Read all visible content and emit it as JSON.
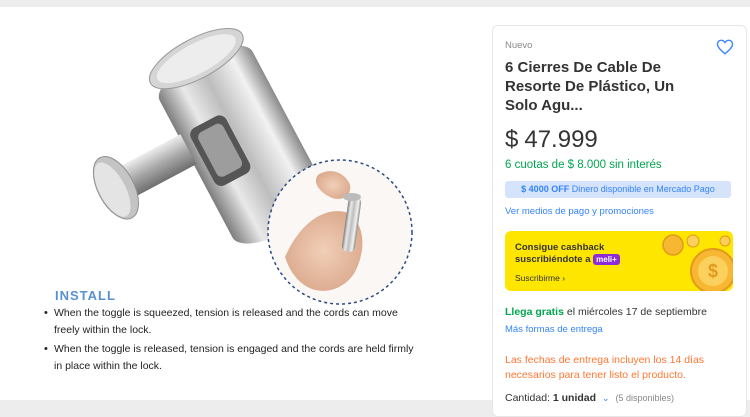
{
  "install": {
    "title": "INSTALL",
    "items": [
      "When the toggle is squeezed, tension is released and the cords can move freely within the lock.",
      "When the toggle is released, tension is engaged and the cords are held firmly in place within the lock."
    ]
  },
  "product": {
    "condition": "Nuevo",
    "title": "6 Cierres De Cable De Resorte De Plástico, Un Solo Agu...",
    "price_currency": "$",
    "price_value": "47.999",
    "installments": "6 cuotas de $ 8.000 sin interés",
    "promo_amount": "$ 4000 OFF",
    "promo_text": "Dinero disponible en Mercado Pago",
    "payment_link": "Ver medios de pago y promociones"
  },
  "cashback": {
    "line1": "Consigue cashback",
    "line2": "suscribiéndote a",
    "badge": "meli+",
    "link": "Suscribirme",
    "link_chevron": "›"
  },
  "shipping": {
    "free": "Llega gratis",
    "date": "el miércoles 17 de septiembre",
    "more": "Más formas de entrega",
    "notice": "Las fechas de entrega incluyen los 14 días necesarios para tener listo el producto."
  },
  "quantity": {
    "label": "Cantidad:",
    "value": "1 unidad",
    "chevron": "⌄",
    "available": "(5 disponibles)"
  },
  "colors": {
    "accent_blue": "#3483fa",
    "green": "#00a650",
    "orange": "#ff7733",
    "yellow": "#ffe600",
    "install_blue": "#5a8fd0"
  }
}
